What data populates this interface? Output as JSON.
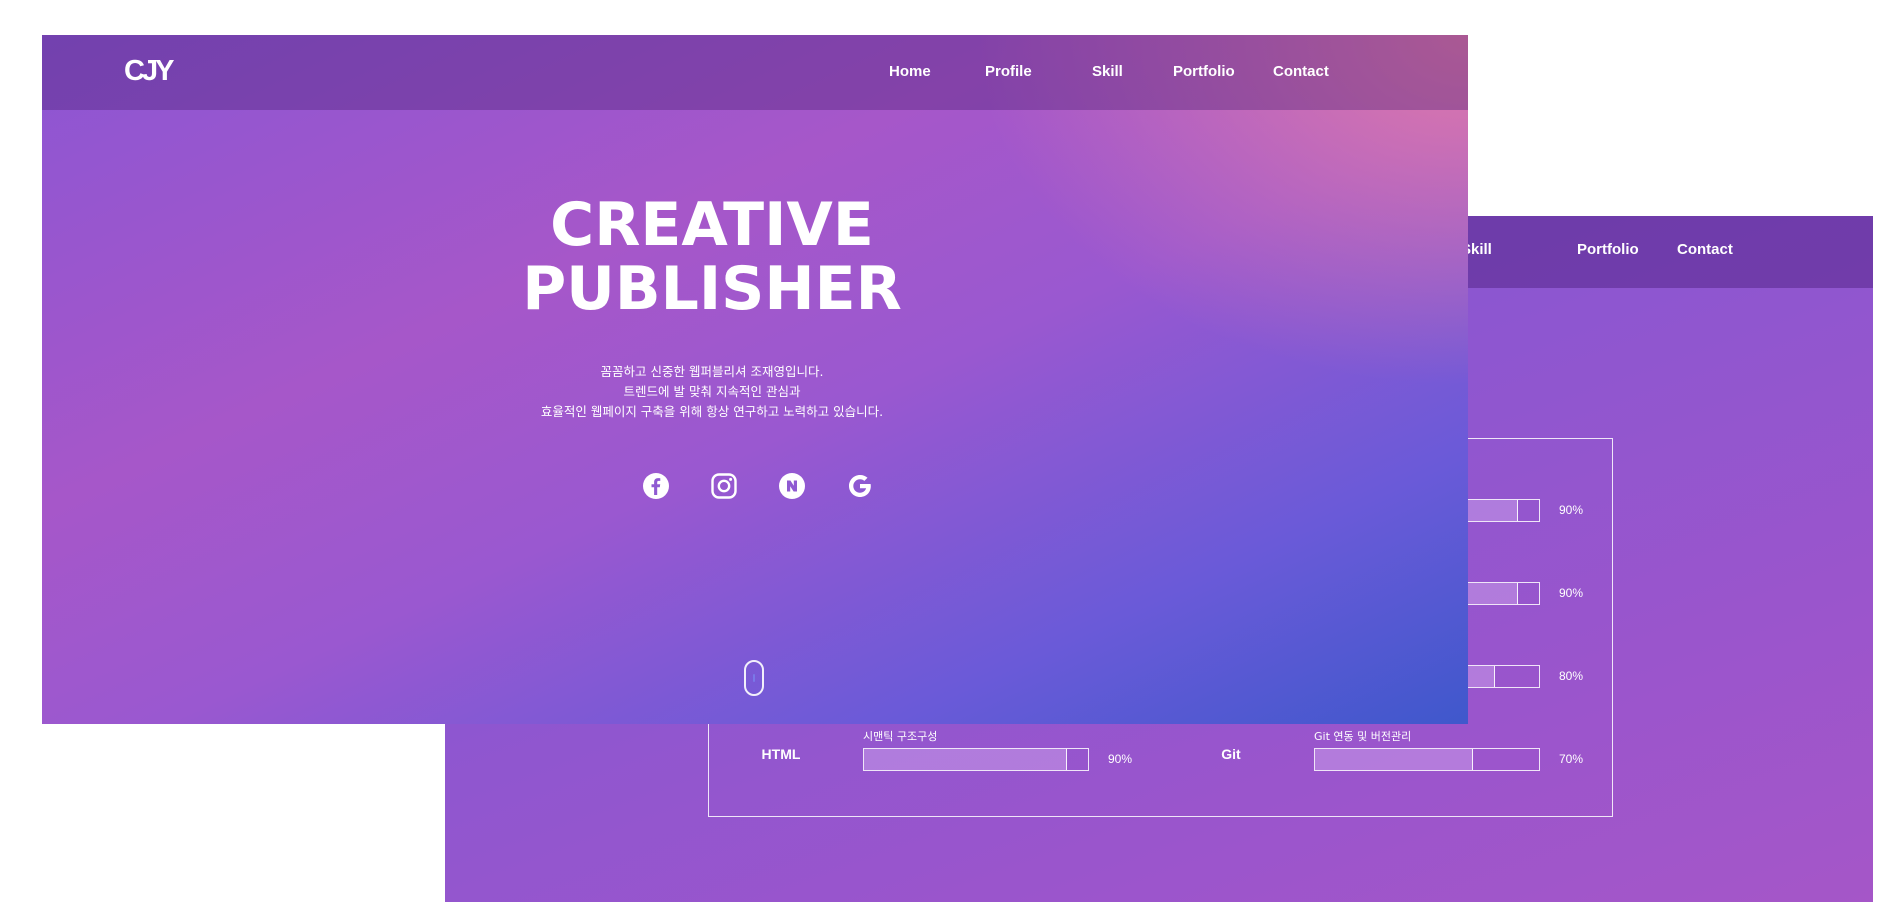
{
  "back_page": {
    "nav": {
      "skill": "Skill",
      "portfolio": "Portfolio",
      "contact": "Contact"
    },
    "skills_right": [
      {
        "name": "",
        "desc": "",
        "percent_label": "90%",
        "level": 0.9
      },
      {
        "name": "",
        "desc": "",
        "percent_label": "90%",
        "level": 0.9
      },
      {
        "name": "",
        "desc": "",
        "percent_label": "80%",
        "level": 0.8
      },
      {
        "name": "Git",
        "desc": "Git 연동 및 버전관리",
        "percent_label": "70%",
        "level": 0.7
      }
    ],
    "skill_left_html": {
      "name": "HTML",
      "desc": "시맨틱 구조구성",
      "percent_label": "90%",
      "level": 0.9
    }
  },
  "front_page": {
    "logo": "CJY",
    "nav": {
      "home": "Home",
      "profile": "Profile",
      "skill": "Skill",
      "portfolio": "Portfolio",
      "contact": "Contact"
    },
    "hero": {
      "title_line1": "CREATIVE",
      "title_line2": "PUBLISHER",
      "desc_line1": "꼼꼼하고 신중한 웹퍼블리셔 조재영입니다.",
      "desc_line2": "트렌드에 발 맞춰 지속적인 관심과",
      "desc_line3": "효율적인 웹페이지 구축을 위해 항상 연구하고 노력하고 있습니다."
    },
    "social_icons": [
      "facebook-icon",
      "instagram-icon",
      "naver-icon",
      "google-icon"
    ]
  },
  "colors": {
    "gradient_blue": "#3f58cc",
    "gradient_purple": "#a657c9",
    "gradient_pink": "#e87da5",
    "back_purple": "#8d56d0"
  }
}
